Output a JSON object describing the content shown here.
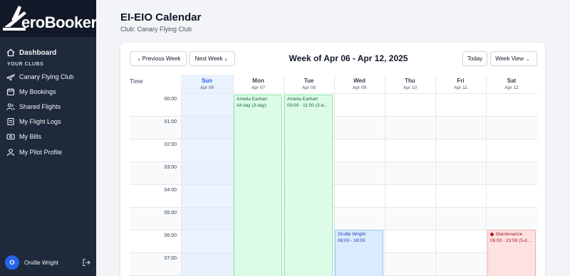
{
  "app": {
    "name": "eroBooker"
  },
  "sidebar": {
    "dashboard_label": "Dashboard",
    "section_label": "YOUR CLUBS",
    "items": [
      {
        "label": "Canary Flying Club",
        "icon": "plane-icon"
      },
      {
        "label": "My Bookings",
        "icon": "calendar-icon"
      },
      {
        "label": "Shared Flights",
        "icon": "users-icon"
      },
      {
        "label": "My Flight Logs",
        "icon": "log-icon"
      },
      {
        "label": "My Bills",
        "icon": "bill-icon"
      },
      {
        "label": "My Pilot Profile",
        "icon": "profile-icon"
      }
    ],
    "user": {
      "initial": "O",
      "name": "Orville Wright"
    }
  },
  "page": {
    "title": "EI-EIO Calendar",
    "subtitle": "Club: Canary Flying Club"
  },
  "toolbar": {
    "prev_label": "Previous Week",
    "next_label": "Next Week",
    "week_title": "Week of Apr 06 - Apr 12, 2025",
    "today_label": "Today",
    "view_label": "Week View"
  },
  "calendar": {
    "time_header": "Time",
    "days": [
      {
        "name": "Sun",
        "date": "Apr 06"
      },
      {
        "name": "Mon",
        "date": "Apr 07"
      },
      {
        "name": "Tue",
        "date": "Apr 08"
      },
      {
        "name": "Wed",
        "date": "Apr 09"
      },
      {
        "name": "Thu",
        "date": "Apr 10"
      },
      {
        "name": "Fri",
        "date": "Apr 11"
      },
      {
        "name": "Sat",
        "date": "Apr 12"
      }
    ],
    "hours": [
      "00:00",
      "01:00",
      "02:00",
      "03:00",
      "04:00",
      "05:00",
      "06:00",
      "07:00"
    ],
    "events": [
      {
        "day": "Mon",
        "name": "Amelia Earhart",
        "time": "All day (3-day)",
        "type": "booking"
      },
      {
        "day": "Tue",
        "name": "Amelia Earhart",
        "time": "00:00 - 11:00 (3-d...",
        "type": "booking"
      },
      {
        "day": "Wed",
        "name": "Orville Wright",
        "time": "06:00 - 18:00",
        "type": "own-booking"
      },
      {
        "day": "Sat",
        "name": "Maintenance",
        "time": "06:00 - 23:59 (5-d...",
        "type": "maintenance"
      }
    ]
  },
  "colors": {
    "sidebar_bg": "#1e293b",
    "accent": "#2563eb",
    "booking_green": "#dcfce7",
    "own_booking_blue": "#dbeafe",
    "maintenance_red": "#fee2e2"
  }
}
